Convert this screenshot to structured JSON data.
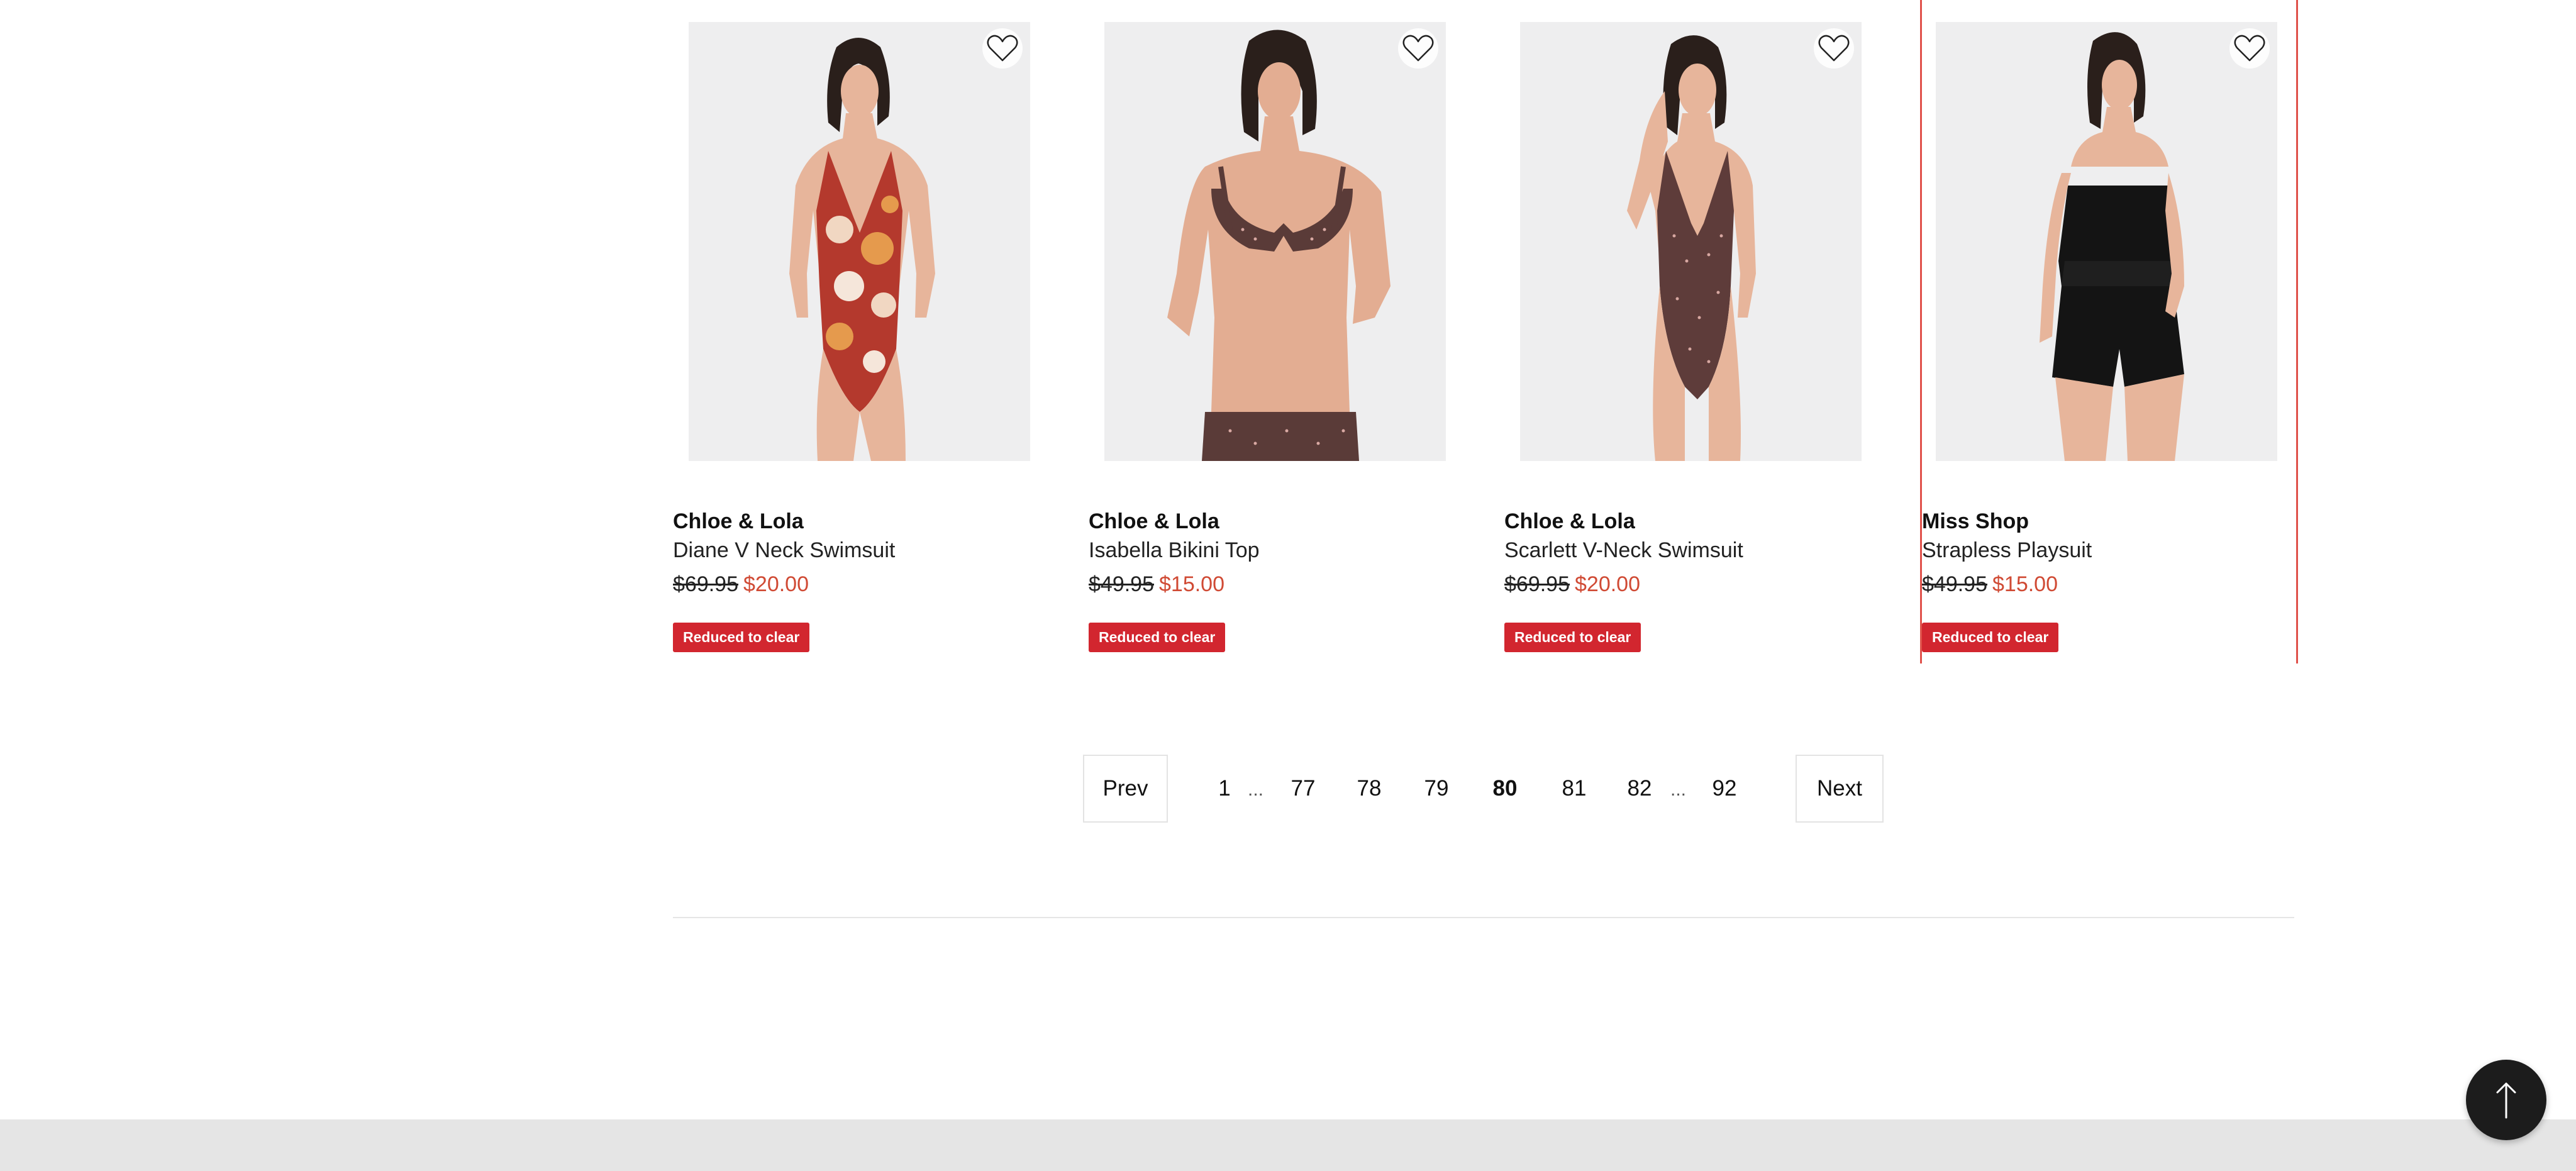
{
  "products": [
    {
      "brand": "Chloe & Lola",
      "name": "Diane V Neck Swimsuit",
      "was_price": "$69.95",
      "now_price": "$20.00",
      "badge": "Reduced to clear",
      "image_icon": "product-photo-floral-swimsuit",
      "wishlist_icon": "heart-outline-icon"
    },
    {
      "brand": "Chloe & Lola",
      "name": "Isabella Bikini Top",
      "was_price": "$49.95",
      "now_price": "$15.00",
      "badge": "Reduced to clear",
      "image_icon": "product-photo-polka-dot-bikini",
      "wishlist_icon": "heart-outline-icon"
    },
    {
      "brand": "Chloe & Lola",
      "name": "Scarlett V-Neck Swimsuit",
      "was_price": "$69.95",
      "now_price": "$20.00",
      "badge": "Reduced to clear",
      "image_icon": "product-photo-polka-dot-swimsuit",
      "wishlist_icon": "heart-outline-icon"
    },
    {
      "brand": "Miss Shop",
      "name": "Strapless Playsuit",
      "was_price": "$49.95",
      "now_price": "$15.00",
      "badge": "Reduced to clear",
      "image_icon": "product-photo-black-playsuit",
      "wishlist_icon": "heart-outline-icon"
    }
  ],
  "pagination": {
    "prev_label": "Prev",
    "next_label": "Next",
    "first": "1",
    "ellipsis": "...",
    "pages": [
      "77",
      "78",
      "79",
      "80",
      "81",
      "82"
    ],
    "current": "80",
    "last": "92"
  },
  "back_to_top_icon": "arrow-up-icon",
  "colors": {
    "sale_price": "#d04a34",
    "badge_bg": "#d2262f",
    "highlight_border": "#e0514a",
    "back_to_top_bg": "#1c1c1c",
    "footer_band": "#e5e5e5"
  }
}
